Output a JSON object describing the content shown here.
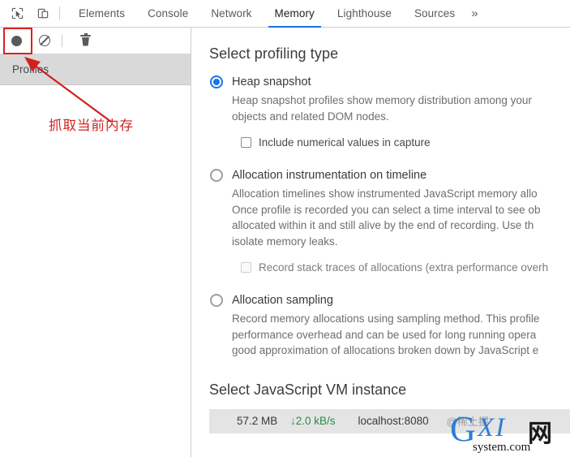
{
  "tabbar": {
    "inspect_icon": "inspect-cursor-icon",
    "device_icon": "device-toolbar-icon",
    "tabs": [
      {
        "label": "Elements",
        "active": false
      },
      {
        "label": "Console",
        "active": false
      },
      {
        "label": "Network",
        "active": false
      },
      {
        "label": "Memory",
        "active": true
      },
      {
        "label": "Lighthouse",
        "active": false
      },
      {
        "label": "Sources",
        "active": false
      }
    ],
    "more_label": "»"
  },
  "sidebar": {
    "toolbar": {
      "record_icon": "record-circle-icon",
      "clear_icon": "no-entry-icon",
      "delete_icon": "trash-icon"
    },
    "profiles_label": "Profiles"
  },
  "main": {
    "profiling_title": "Select profiling type",
    "options": [
      {
        "id": "heap-snapshot",
        "label": "Heap snapshot",
        "selected": true,
        "description": "Heap snapshot profiles show memory distribution among your\nobjects and related DOM nodes.",
        "checkbox": {
          "label": "Include numerical values in capture",
          "checked": false,
          "disabled": false
        }
      },
      {
        "id": "allocation-instrumentation-on-timeline",
        "label": "Allocation instrumentation on timeline",
        "selected": false,
        "description": "Allocation timelines show instrumented JavaScript memory allo\nOnce profile is recorded you can select a time interval to see ob\nallocated within it and still alive by the end of recording. Use th\nisolate memory leaks.",
        "checkbox": {
          "label": "Record stack traces of allocations (extra performance overh",
          "checked": false,
          "disabled": true
        }
      },
      {
        "id": "allocation-sampling",
        "label": "Allocation sampling",
        "selected": false,
        "description": "Record memory allocations using sampling method. This profile\nperformance overhead and can be used for long running opera\ngood approximation of allocations broken down by JavaScript e",
        "checkbox": null
      }
    ],
    "vm_title": "Select JavaScript VM instance",
    "vm_row": {
      "size": "57.2 MB",
      "rate": "↓2.0 kB/s",
      "rate_color": "#2e8b45",
      "host": "localhost:8080",
      "extra": "@稀土掘"
    }
  },
  "annotation": {
    "text": "抓取当前内存",
    "color": "#d22020"
  },
  "watermark": {
    "g": "G",
    "xi": "XI",
    "cn": "网",
    "sub": "system.com"
  }
}
